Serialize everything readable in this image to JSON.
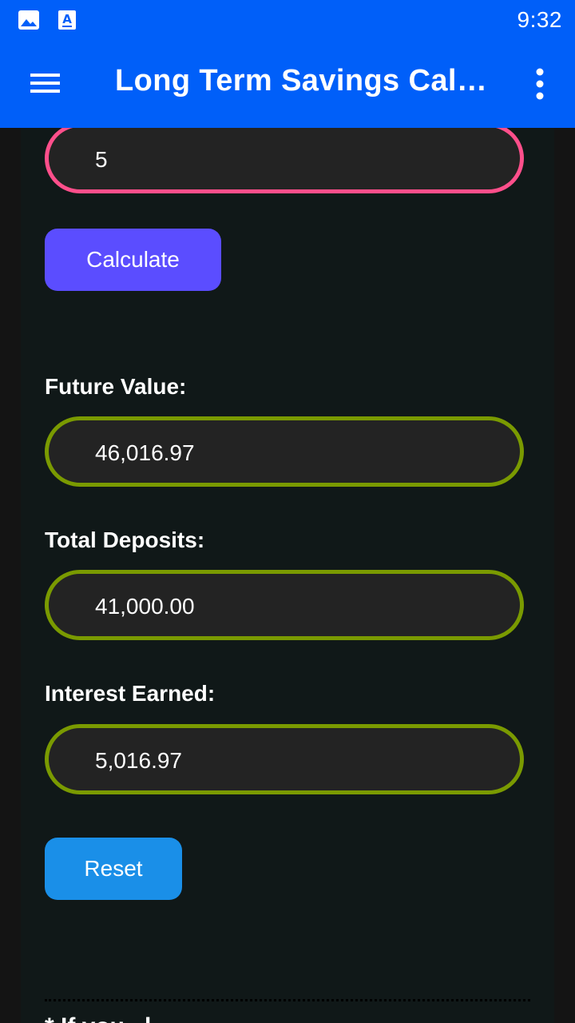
{
  "status_bar": {
    "time": "9:32",
    "icons": [
      "image-icon",
      "text-a-icon"
    ]
  },
  "app_bar": {
    "title": "Long Term Savings Calculator",
    "menu_icon": "hamburger-menu-icon",
    "more_icon": "more-vert-icon"
  },
  "form": {
    "years_value": "5",
    "calculate_label": "Calculate"
  },
  "results": {
    "future_value_label": "Future Value:",
    "future_value": "46,016.97",
    "total_deposits_label": "Total Deposits:",
    "total_deposits": "41,000.00",
    "interest_earned_label": "Interest Earned:",
    "interest_earned": "5,016.97",
    "reset_label": "Reset"
  },
  "note": {
    "text": "* If you...l ..."
  },
  "colors": {
    "app_bar": "#005ff9",
    "input_border": "#ff4f8b",
    "output_border": "#7a9a01",
    "calculate_button": "#5b4dff",
    "reset_button": "#1a8fe8"
  }
}
